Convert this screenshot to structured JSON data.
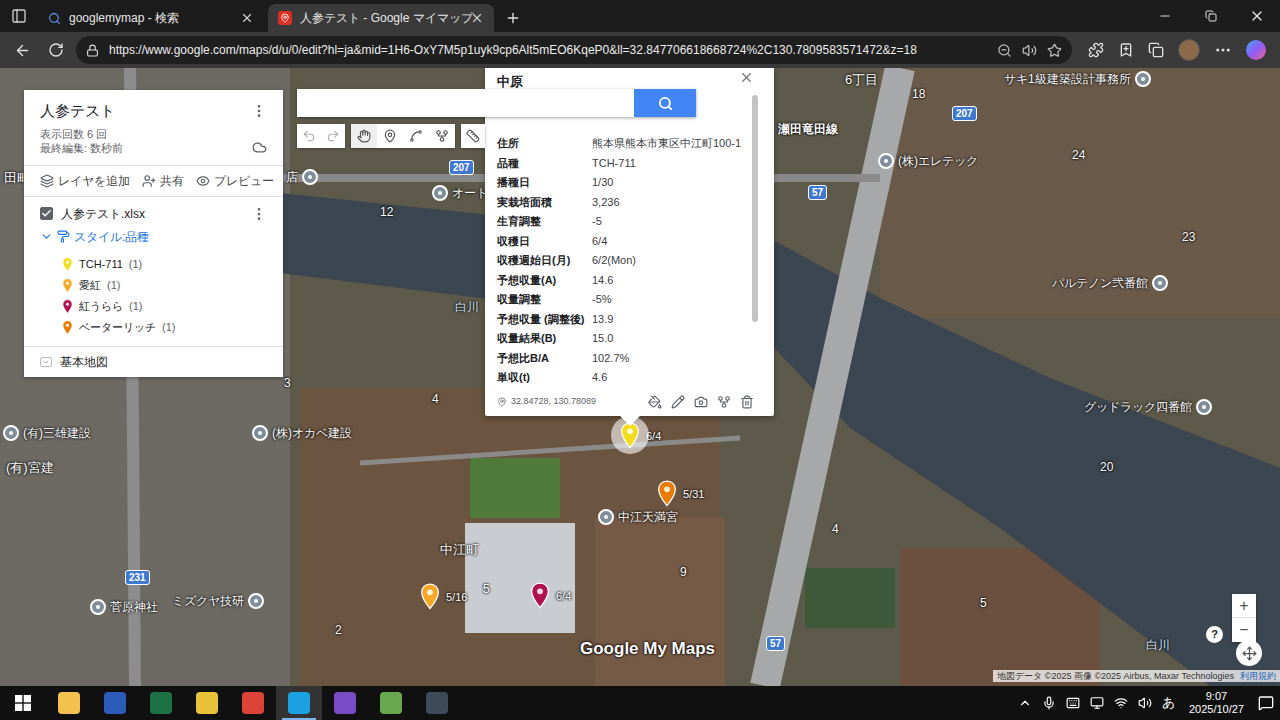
{
  "browser": {
    "tabs": [
      {
        "label": "googlemymap - 検索",
        "selected": false
      },
      {
        "label": "人参テスト - Google マイマップ",
        "selected": true
      }
    ],
    "url": "https://www.google.com/maps/d/u/0/edit?hl=ja&mid=1H6-OxY7M5p1uyk9cp6Alt5mEO6KqeP0&ll=32.847706618668724%2C130.7809583571472&z=18"
  },
  "sidebar": {
    "title": "人参テスト",
    "views": "表示回数 6 回",
    "last_edit": "最終編集: 数秒前",
    "actions": [
      "レイヤを追加",
      "共有",
      "プレビュー"
    ],
    "layer": {
      "name": "人参テスト.xlsx",
      "checked": true,
      "expanded": true,
      "style_label": "スタイル:品種",
      "legend": [
        {
          "label": "TCH-711",
          "count": "(1)",
          "color": "#f4dc1c"
        },
        {
          "label": "愛紅",
          "count": "(1)",
          "color": "#f9a825"
        },
        {
          "label": "紅うらら",
          "count": "(1)",
          "color": "#b0124f"
        },
        {
          "label": "ベーターリッチ",
          "count": "(1)",
          "color": "#e67c00"
        }
      ]
    },
    "base_map": "基本地図"
  },
  "popup": {
    "title": "中原",
    "fields": [
      {
        "label": "住所",
        "value": "熊本県熊本市東区中江町100-1"
      },
      {
        "label": "品種",
        "value": "TCH-711"
      },
      {
        "label": "播種日",
        "value": "1/30"
      },
      {
        "label": "実栽培面積",
        "value": "3,236"
      },
      {
        "label": "生育調整",
        "value": "-5"
      },
      {
        "label": "収穫日",
        "value": "6/4"
      },
      {
        "label": "収穫週始日(月)",
        "value": "6/2(Mon)"
      },
      {
        "label": "予想収量(A)",
        "value": "14.6"
      },
      {
        "label": "収量調整",
        "value": "-5%"
      },
      {
        "label": "予想収量 (調整後)",
        "value": "13.9"
      },
      {
        "label": "収量結果(B)",
        "value": "15.0"
      },
      {
        "label": "予想比B/A",
        "value": "102.7%"
      },
      {
        "label": "単収(t)",
        "value": "4.6"
      }
    ],
    "coords": "32.84728, 130.78089"
  },
  "map": {
    "labels": [
      {
        "text": "6丁目",
        "kind": "place"
      },
      {
        "text": "サキ1級建築設計事務所",
        "kind": "poi-end"
      },
      {
        "text": "18",
        "kind": "number"
      },
      {
        "text": "207",
        "kind": "shield"
      },
      {
        "text": "瀬田竜田線",
        "kind": "road"
      },
      {
        "text": "(株)エレテック",
        "kind": "poi"
      },
      {
        "text": "24",
        "kind": "number"
      },
      {
        "text": "23",
        "kind": "number"
      },
      {
        "text": "パルテノン弐番館",
        "kind": "poi-end"
      },
      {
        "text": "白川",
        "kind": "river"
      },
      {
        "text": "12",
        "kind": "number"
      },
      {
        "text": "207",
        "kind": "shield"
      },
      {
        "text": "店",
        "kind": "poi-end"
      },
      {
        "text": "オート",
        "kind": "poi"
      },
      {
        "text": "57",
        "kind": "shield"
      },
      {
        "text": "田町",
        "kind": "place"
      },
      {
        "text": "3",
        "kind": "number"
      },
      {
        "text": "4",
        "kind": "number"
      },
      {
        "text": "(株)オカベ建設",
        "kind": "poi"
      },
      {
        "text": "(有)三雄建設",
        "kind": "poi"
      },
      {
        "text": "(有)宮建",
        "kind": "place"
      },
      {
        "text": "グッドラック四番館",
        "kind": "poi-end"
      },
      {
        "text": "20",
        "kind": "number"
      },
      {
        "text": "中江天満宮",
        "kind": "poi"
      },
      {
        "text": "中江町",
        "kind": "place"
      },
      {
        "text": "9",
        "kind": "number"
      },
      {
        "text": "4",
        "kind": "number"
      },
      {
        "text": "231",
        "kind": "shield"
      },
      {
        "text": "ミズクヤ技研",
        "kind": "poi-end"
      },
      {
        "text": "菅原神社",
        "kind": "poi"
      },
      {
        "text": "2",
        "kind": "number"
      },
      {
        "text": "5",
        "kind": "number"
      },
      {
        "text": "5",
        "kind": "number"
      },
      {
        "text": "57",
        "kind": "shield"
      },
      {
        "text": "白川",
        "kind": "river"
      }
    ],
    "pins": [
      {
        "label": "6/4",
        "color": "#f4dc1c",
        "selected": true
      },
      {
        "label": "5/31",
        "color": "#e67c00",
        "selected": false
      },
      {
        "label": "5/16",
        "color": "#f9a825",
        "selected": false
      },
      {
        "label": "6/4",
        "color": "#b0124f",
        "selected": false
      }
    ],
    "logo": "Google My Maps",
    "zoom": [
      "+",
      "−"
    ],
    "help": "?",
    "attribution": "地図データ ©2025 画像 ©2025 Airbus, Maxar Technologies",
    "terms": "利用規約"
  },
  "taskbar": {
    "apps": [
      {
        "color": "#f2c14e",
        "active": false
      },
      {
        "color": "#2b5cb8",
        "active": false
      },
      {
        "color": "#1e7145",
        "active": false
      },
      {
        "color": "#e8c33a",
        "active": false
      },
      {
        "color": "#db4437",
        "active": false
      },
      {
        "color": "#1ba1e2",
        "active": true
      },
      {
        "color": "#7a4bc9",
        "active": false
      },
      {
        "color": "#6aa84f",
        "active": false
      },
      {
        "color": "#3c4a5a",
        "active": false
      }
    ],
    "ime": "あ",
    "time": "9:07",
    "date": "2025/10/27"
  }
}
